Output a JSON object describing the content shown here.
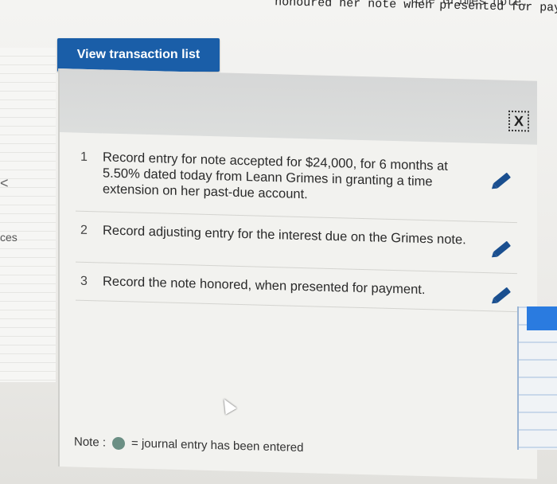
{
  "header_text": {
    "line1_tail": "the Grimes note.",
    "line2": "honoured her note when presented for payment."
  },
  "sidebar": {
    "glyph": "<",
    "fragment": "ces"
  },
  "view_button": {
    "label": "View transaction list"
  },
  "close_icon": "X",
  "transactions": [
    {
      "number": "1",
      "description": "Record entry for note accepted for $24,000, for 6 months at 5.50% dated today from Leann Grimes in granting a time extension on her past-due account."
    },
    {
      "number": "2",
      "description": "Record adjusting entry for the interest due on the Grimes note."
    },
    {
      "number": "3",
      "description": "Record the note honored, when presented for payment."
    }
  ],
  "note": {
    "label": "Note :",
    "text": "= journal entry has been entered"
  },
  "colors": {
    "button_bg": "#1a5ea8",
    "pencil": "#1a4f8f",
    "entered_dot": "#6b8f84"
  }
}
